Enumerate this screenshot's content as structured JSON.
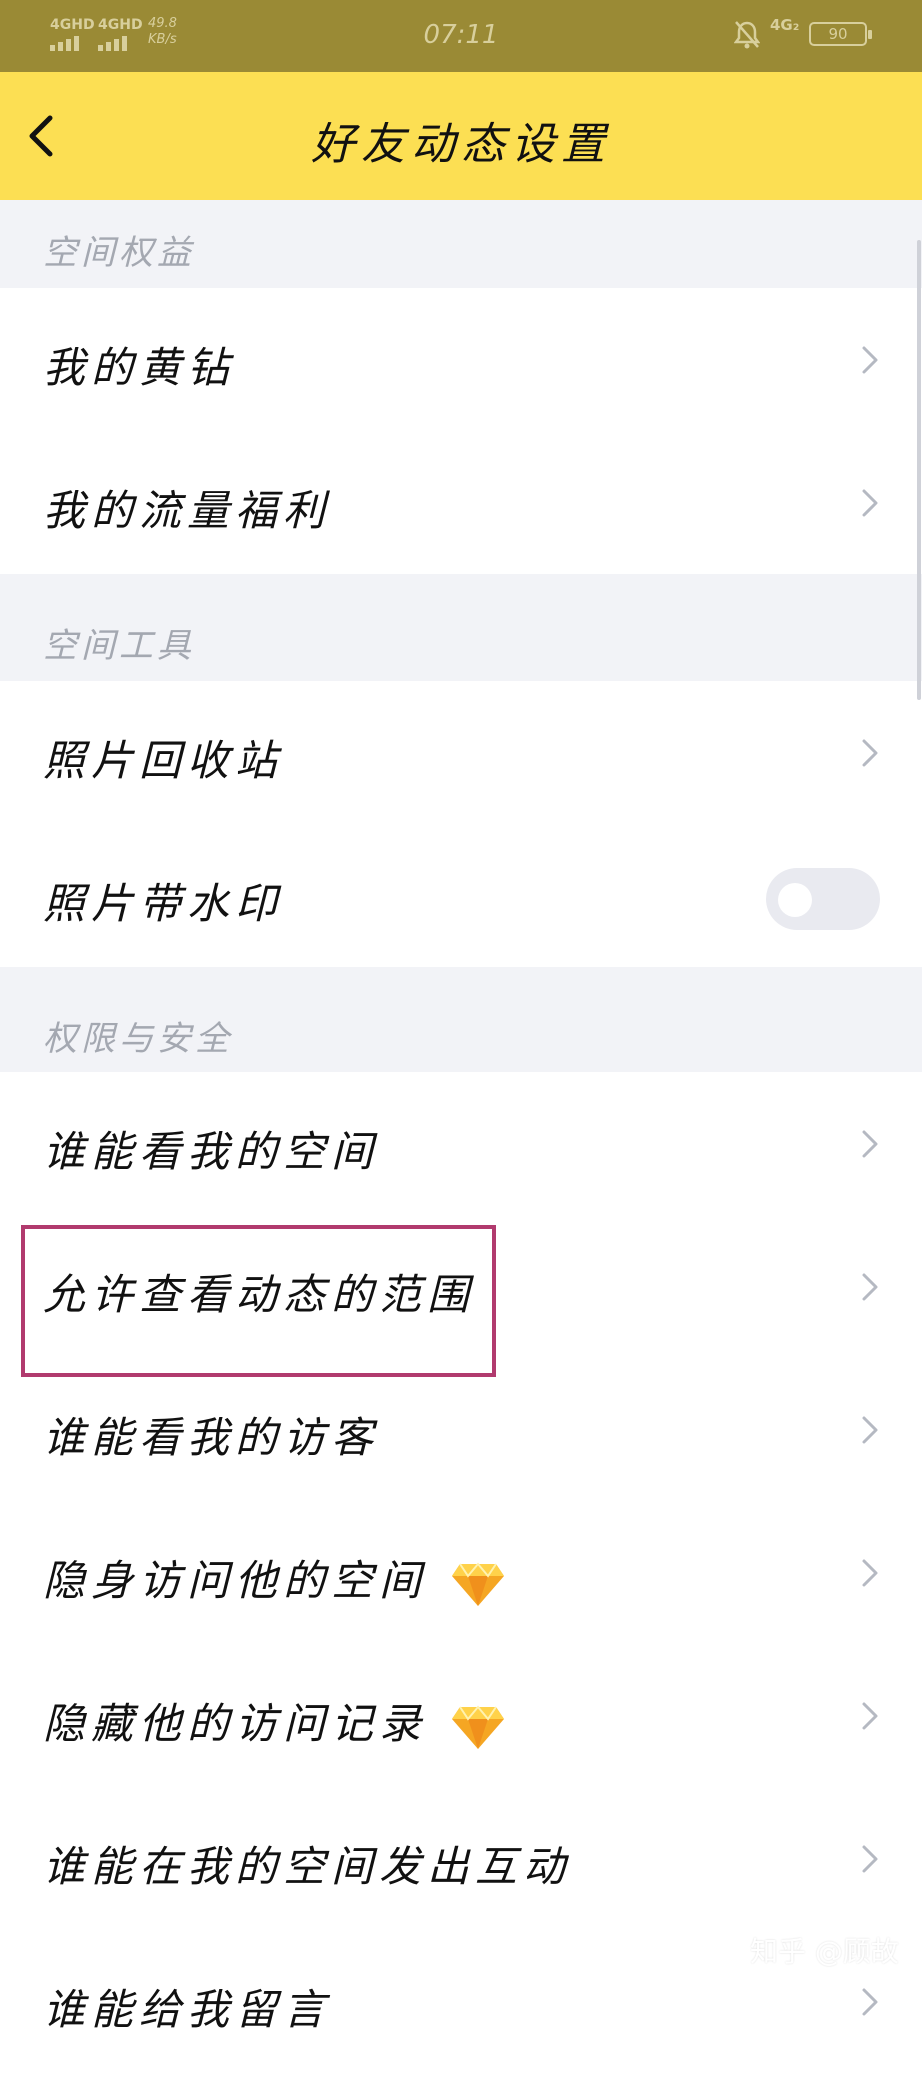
{
  "status_bar": {
    "sim1": "4GHD",
    "sim2": "4GHD",
    "speed_value": "49.8",
    "speed_unit": "KB/s",
    "time": "07:11",
    "network": "4G₂",
    "battery": "90"
  },
  "header": {
    "title": "好友动态设置"
  },
  "sections": {
    "space_rights": "空间权益",
    "space_tools": "空间工具",
    "privacy": "权限与安全"
  },
  "rows": {
    "yellow_diamond": "我的黄钻",
    "data_benefit": "我的流量福利",
    "photo_recycle": "照片回收站",
    "photo_watermark": "照片带水印",
    "who_view_space": "谁能看我的空间",
    "view_scope": "允许查看动态的范围",
    "who_view_visitors": "谁能看我的访客",
    "stealth_visit": "隐身访问他的空间",
    "hide_visit_record": "隐藏他的访问记录",
    "who_interact": "谁能在我的空间发出互动",
    "partial_last": "谁能给我留言"
  },
  "toggles": {
    "photo_watermark_on": false
  },
  "colors": {
    "accent_yellow": "#fcdf53",
    "highlight_border": "#b13a6e"
  },
  "icons": {
    "back": "chevron-left-icon",
    "row_arrow": "chevron-right-icon",
    "vip": "diamond-icon"
  },
  "watermark": "知乎 @顾故"
}
